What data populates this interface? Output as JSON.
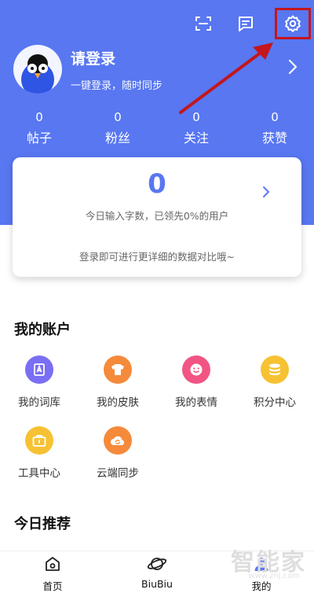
{
  "header": {
    "icons": [
      "scan-icon",
      "message-icon",
      "settings-icon"
    ]
  },
  "profile": {
    "title": "请登录",
    "subtitle": "一键登录，随时同步"
  },
  "stats": [
    {
      "value": "0",
      "label": "帖子"
    },
    {
      "value": "0",
      "label": "粉丝"
    },
    {
      "value": "0",
      "label": "关注"
    },
    {
      "value": "0",
      "label": "获赞"
    }
  ],
  "card": {
    "count": "0",
    "line1": "今日输入字数，已领先0%的用户",
    "line2": "登录即可进行更详细的数据对比哦~"
  },
  "account": {
    "title": "我的账户",
    "items": [
      {
        "label": "我的词库",
        "color": "#7a6ef2",
        "icon": "wordbank-icon"
      },
      {
        "label": "我的皮肤",
        "color": "#f58a3b",
        "icon": "skin-icon"
      },
      {
        "label": "我的表情",
        "color": "#f25583",
        "icon": "emoji-icon"
      },
      {
        "label": "积分中心",
        "color": "#f6c233",
        "icon": "points-icon"
      },
      {
        "label": "工具中心",
        "color": "#f6c233",
        "icon": "toolbox-icon"
      },
      {
        "label": "云端同步",
        "color": "#f58a3b",
        "icon": "cloud-sync-icon"
      }
    ]
  },
  "recommend": {
    "title": "今日推荐"
  },
  "nav": [
    {
      "label": "首页",
      "icon": "home-icon"
    },
    {
      "label": "BiuBiu",
      "icon": "planet-icon"
    },
    {
      "label": "我的",
      "icon": "profile-icon"
    }
  ],
  "watermark": {
    "text": "智能家",
    "url": "www.znj.com"
  },
  "colors": {
    "primary": "#5877f1",
    "highlight": "#c4161c"
  }
}
